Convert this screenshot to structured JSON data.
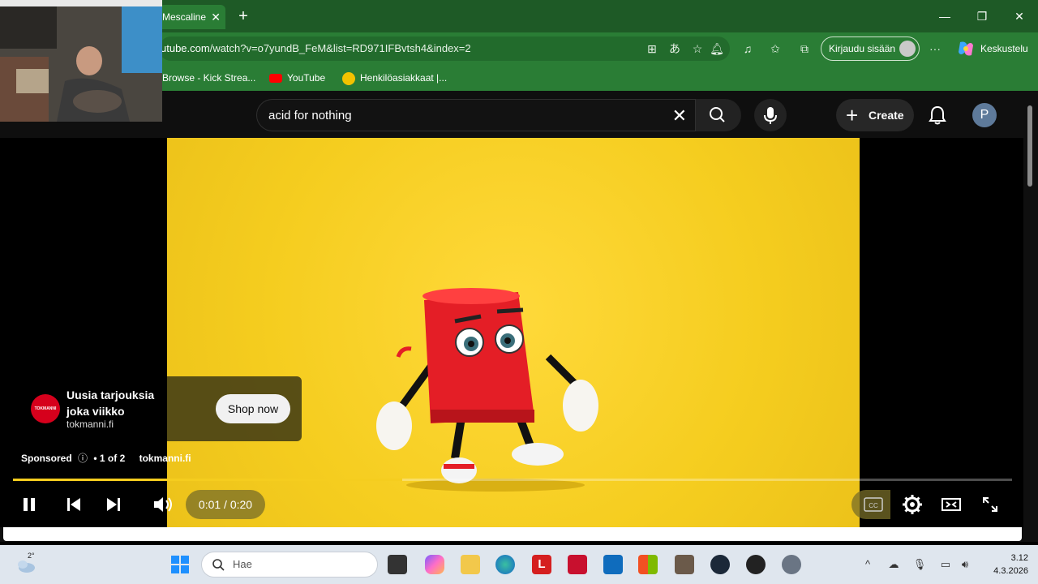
{
  "browser": {
    "tab_title": "Mescaline",
    "url_host": "utube.com",
    "url_path": "/watch?v=o7yundB_FeM&list=RD971IFBvtsh4&index=2",
    "signin_label": "Kirjaudu sisään",
    "copilot_label": "Keskustelu",
    "bookmarks": [
      {
        "label": "Browse - Kick Strea..."
      },
      {
        "label": "YouTube"
      },
      {
        "label": "Henkilöasiakkaat |..."
      }
    ]
  },
  "youtube": {
    "search_query": "acid for nothing",
    "create_label": "Create",
    "avatar_letter": "P"
  },
  "ad": {
    "logo_text": "TOKMANNI",
    "title": "Uusia tarjouksia joka viikko",
    "domain": "tokmanni.fi",
    "cta": "Shop now",
    "sponsored": "Sponsored",
    "info_icon": "ⓘ",
    "count": "• 1 of 2",
    "domain_short": "tokmanni.fi"
  },
  "player": {
    "time": "0:01 / 0:20",
    "progress_fraction": 0.39,
    "cc_label": "CC"
  },
  "taskbar": {
    "search_placeholder": "Hae",
    "weather_temp": "2°",
    "time": "3.12",
    "date": "4.3.2026"
  },
  "colors": {
    "browser_green": "#2a7d35",
    "yt_dark": "#0f0f0f",
    "video_yellow": "#f5cd1f",
    "mascot_red": "#e41e26"
  }
}
